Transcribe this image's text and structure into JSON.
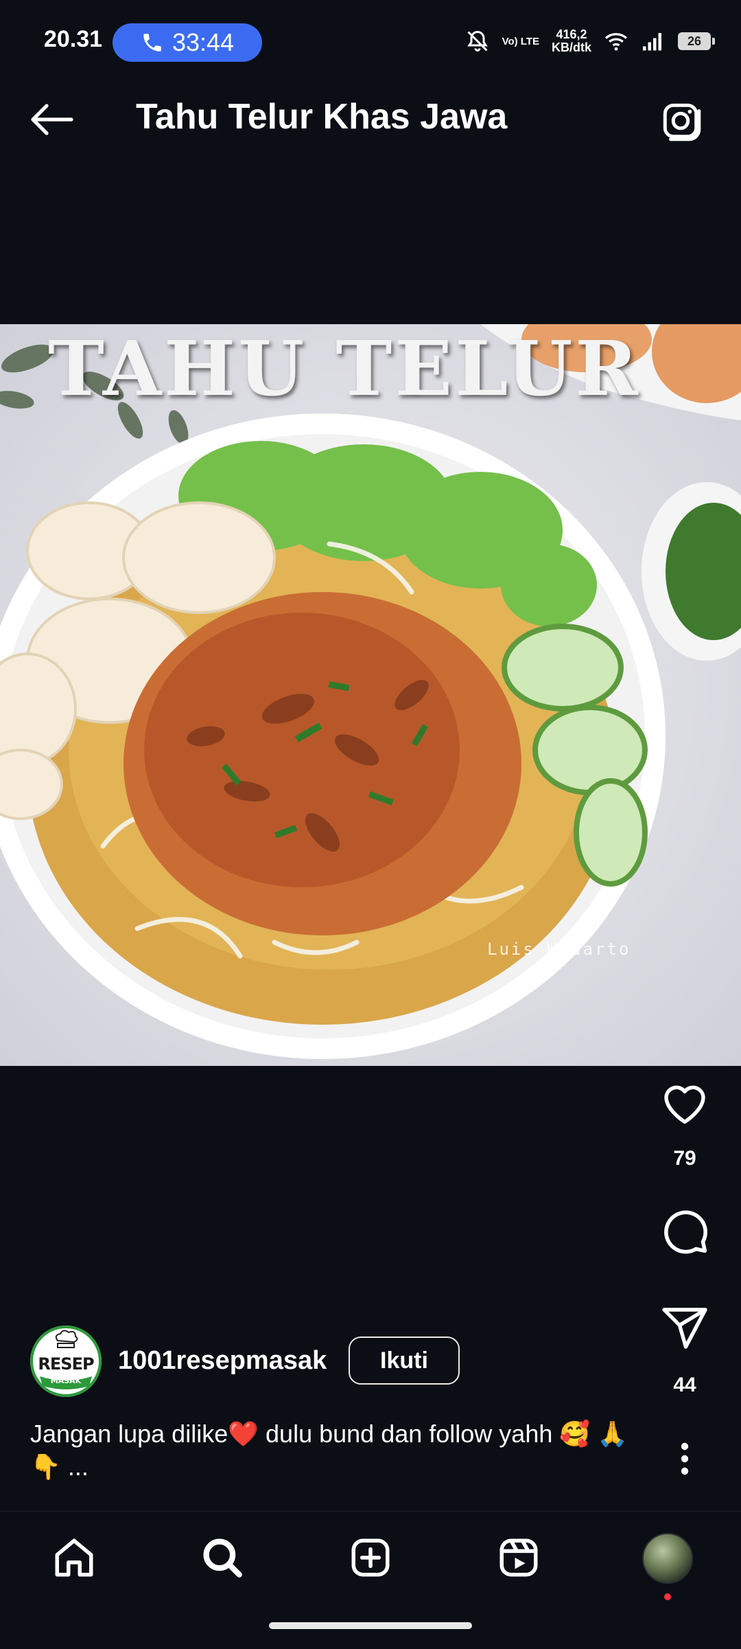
{
  "status_bar": {
    "time": "20.31",
    "call_timer": "33:44",
    "volte_label": "Vo) LTE",
    "net_speed_value": "416,2",
    "net_speed_unit": "KB/dtk",
    "battery": "26"
  },
  "header": {
    "title": "Tahu Telur Khas Jawa"
  },
  "photo": {
    "overlay_title": "TAHU TELUR",
    "watermark": "Luis Widarto"
  },
  "actions": {
    "likes": "79",
    "shares": "44"
  },
  "author": {
    "logo_text_top": "RESEP",
    "logo_text_bottom": "MASAK",
    "username": "1001resepmasak",
    "follow_label": "Ikuti"
  },
  "caption": {
    "text": "Jangan lupa dilike❤️ dulu bund dan follow yahh 🥰 🙏 👇 ..."
  },
  "bottom_nav": {
    "items": [
      "home-icon",
      "search-icon",
      "add-post-icon",
      "reels-icon",
      "profile-avatar"
    ]
  },
  "colors": {
    "background": "#0b0e14",
    "call_pill": "#3b6bf0",
    "notification_dot": "#ff3040"
  }
}
